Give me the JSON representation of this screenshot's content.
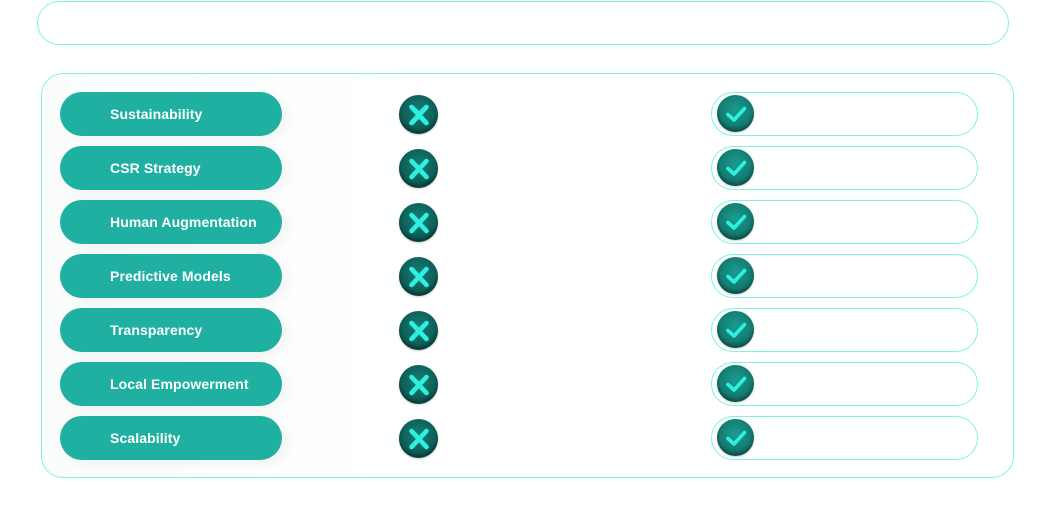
{
  "features": [
    {
      "label": "Sustainability",
      "left_icon": "x-icon",
      "right_icon": "check-icon"
    },
    {
      "label": "CSR Strategy",
      "left_icon": "x-icon",
      "right_icon": "check-icon"
    },
    {
      "label": "Human Augmentation",
      "left_icon": "x-icon",
      "right_icon": "check-icon"
    },
    {
      "label": "Predictive Models",
      "left_icon": "x-icon",
      "right_icon": "check-icon"
    },
    {
      "label": "Transparency",
      "left_icon": "x-icon",
      "right_icon": "check-icon"
    },
    {
      "label": "Local Empowerment",
      "left_icon": "x-icon",
      "right_icon": "check-icon"
    },
    {
      "label": "Scalability",
      "left_icon": "x-icon",
      "right_icon": "check-icon"
    }
  ],
  "colors": {
    "pill_fill": "#1fb0a2",
    "outline": "#7ff3df",
    "icon_dark": "#0d5e57",
    "icon_glyph": "#2ef0e0"
  }
}
